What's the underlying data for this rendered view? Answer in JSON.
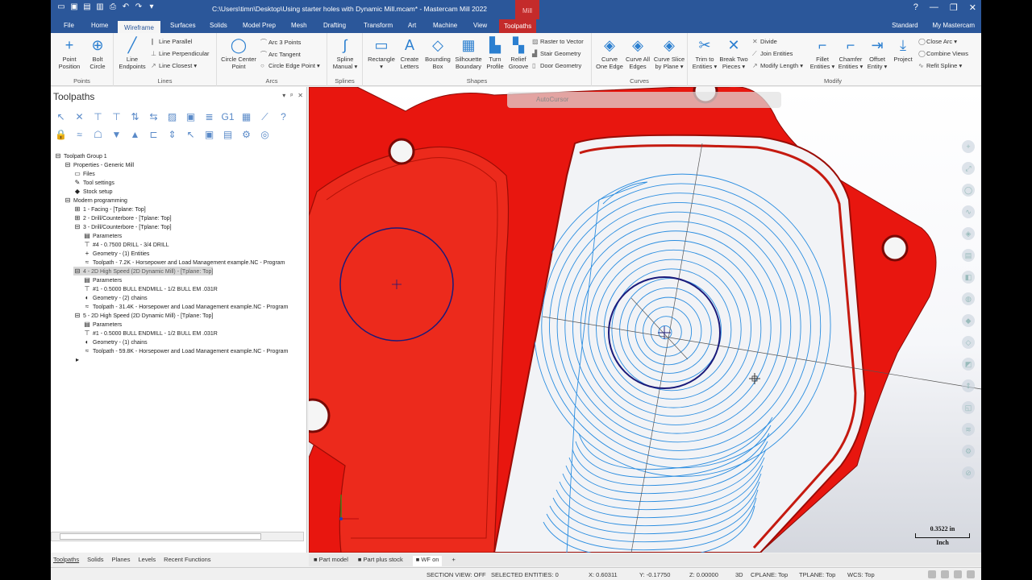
{
  "window": {
    "title": "C:\\Users\\timn\\Desktop\\Using starter holes with Dynamic Mill.mcam* - Mastercam Mill 2022",
    "context_tag": "Mill",
    "minimize": "—",
    "restore": "❐",
    "close": "✕"
  },
  "tabs": [
    "File",
    "Home",
    "Wireframe",
    "Surfaces",
    "Solids",
    "Model Prep",
    "Mesh",
    "Drafting",
    "Transform",
    "Art",
    "Machine",
    "View",
    "Toolpaths"
  ],
  "active_tab": "Wireframe",
  "right_tabs": {
    "workspace": "Standard",
    "my_mastercam": "My Mastercam"
  },
  "ribbon": {
    "points": {
      "label": "Points",
      "point_position": "Point Position",
      "bolt_circle": "Bolt Circle"
    },
    "lines": {
      "label": "Lines",
      "line_endpoints": "Line Endpoints",
      "line_parallel": "Line Parallel",
      "line_perpendicular": "Line Perpendicular",
      "line_closest": "Line Closest"
    },
    "arcs": {
      "label": "Arcs",
      "circle_center_point": "Circle Center Point",
      "arc_3_points": "Arc 3 Points",
      "arc_tangent": "Arc Tangent",
      "circle_edge_point": "Circle Edge Point"
    },
    "splines": {
      "label": "Splines",
      "spline_manual": "Spline Manual"
    },
    "shapes": {
      "label": "Shapes",
      "rectangle": "Rectangle",
      "create_letters": "Create Letters",
      "bounding_box": "Bounding Box",
      "silhouette_boundary": "Silhouette Boundary",
      "turn_profile": "Turn Profile",
      "relief_groove": "Relief Groove",
      "raster_to_vector": "Raster to Vector",
      "stair_geometry": "Stair Geometry",
      "door_geometry": "Door Geometry"
    },
    "curves": {
      "label": "Curves",
      "curve_one_edge": "Curve One Edge",
      "curve_all_edges": "Curve All Edges",
      "curve_slice_by_plane": "Curve Slice by Plane"
    },
    "modify": {
      "label": "Modify",
      "trim_to_entities": "Trim to Entities",
      "break_two_pieces": "Break Two Pieces",
      "divide": "Divide",
      "join_entities": "Join Entities",
      "modify_length": "Modify Length",
      "fillet_entities": "Fillet Entities",
      "chamfer_entities": "Chamfer Entities",
      "offset_entity": "Offset Entity",
      "project": "Project",
      "close_arc": "Close Arc",
      "combine_views": "Combine Views",
      "refit_spline": "Refit Spline"
    }
  },
  "panel": {
    "title": "Toolpaths",
    "pin": "ᵖ",
    "dropdown": "▾",
    "close": "✕",
    "tree": [
      {
        "text": "Toolpath Group 1",
        "level": 0,
        "icon": "⊟"
      },
      {
        "text": "Properties - Generic Mill",
        "level": 1,
        "icon": "⊟"
      },
      {
        "text": "Files",
        "level": 2,
        "icon": "▭"
      },
      {
        "text": "Tool settings",
        "level": 2,
        "icon": "✎"
      },
      {
        "text": "Stock setup",
        "level": 2,
        "icon": "◆"
      },
      {
        "text": "Modern programming",
        "level": 1,
        "icon": "⊟"
      },
      {
        "text": "1 - Facing - [Tplane: Top]",
        "level": 2,
        "icon": "⊞"
      },
      {
        "text": "2 - Drill/Counterbore - [Tplane: Top]",
        "level": 2,
        "icon": "⊞"
      },
      {
        "text": "3 - Drill/Counterbore - [Tplane: Top]",
        "level": 2,
        "icon": "⊟"
      },
      {
        "text": "Parameters",
        "level": 3,
        "icon": "▤"
      },
      {
        "text": "#4 - 0.7500 DRILL - 3/4 DRILL",
        "level": 3,
        "icon": "⊤"
      },
      {
        "text": "Geometry - (1) Entities",
        "level": 3,
        "icon": "+"
      },
      {
        "text": "Toolpath - 7.2K - Horsepower and Load Management example.NC - Program",
        "level": 3,
        "icon": "≈"
      },
      {
        "text": "4 - 2D High Speed (2D Dynamic Mill) - [Tplane: Top]",
        "level": 2,
        "icon": "⊟",
        "selected": true
      },
      {
        "text": "Parameters",
        "level": 3,
        "icon": "▤"
      },
      {
        "text": "#1 - 0.5000 BULL ENDMILL - 1/2 BULL EM .031R",
        "level": 3,
        "icon": "⊤"
      },
      {
        "text": "Geometry - (2) chains",
        "level": 3,
        "icon": "◐"
      },
      {
        "text": "Toolpath - 31.4K - Horsepower and Load Management example.NC - Program",
        "level": 3,
        "icon": "≈"
      },
      {
        "text": "5 - 2D High Speed (2D Dynamic Mill) - [Tplane: Top]",
        "level": 2,
        "icon": "⊟"
      },
      {
        "text": "Parameters",
        "level": 3,
        "icon": "▤"
      },
      {
        "text": "#1 - 0.5000 BULL ENDMILL - 1/2 BULL EM .031R",
        "level": 3,
        "icon": "⊤"
      },
      {
        "text": "Geometry - (1) chains",
        "level": 3,
        "icon": "◐"
      },
      {
        "text": "Toolpath - 59.8K - Horsepower and Load Management example.NC - Program",
        "level": 3,
        "icon": "≈"
      },
      {
        "text": "",
        "level": 2,
        "icon": "▸"
      }
    ],
    "bottom_tabs": [
      "Toolpaths",
      "Solids",
      "Planes",
      "Levels",
      "Recent Functions"
    ]
  },
  "viewport": {
    "toolbar_label": "AutoCursor",
    "scale_value": "0.3522 in",
    "scale_unit": "Inch",
    "part_color": "#e8160f",
    "toolpath_color": "#2a8de0",
    "circle_color": "#1a1a7a"
  },
  "view_tabs": [
    "Part model",
    "Part plus stock",
    "WF on"
  ],
  "view_tabs_add": "+",
  "status": {
    "section_view": "SECTION VIEW: OFF",
    "selected": "SELECTED ENTITIES: 0",
    "x": "X:   0.60311",
    "y": "Y:   -0.17750",
    "z": "Z:   0.00000",
    "mode": "3D",
    "cplane": "CPLANE: Top",
    "tplane": "TPLANE: Top",
    "wcs": "WCS: Top"
  }
}
